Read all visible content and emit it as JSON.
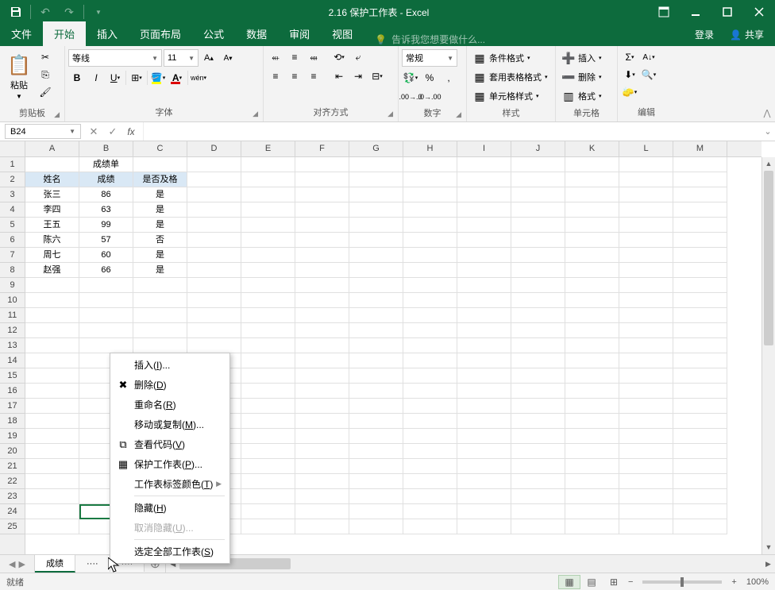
{
  "title": "2.16 保护工作表 - Excel",
  "qat": {
    "save": "💾"
  },
  "menubar_right": {
    "login": "登录",
    "share": "共享"
  },
  "tell_me": "告诉我您想要做什么...",
  "tabs": {
    "file": "文件",
    "home": "开始",
    "insert": "插入",
    "layout": "页面布局",
    "formulas": "公式",
    "data": "数据",
    "review": "审阅",
    "view": "视图"
  },
  "ribbon": {
    "clipboard": {
      "paste": "粘贴",
      "label": "剪贴板"
    },
    "font": {
      "name": "等线",
      "size": "11",
      "label": "字体"
    },
    "align": {
      "label": "对齐方式"
    },
    "number": {
      "format": "常规",
      "label": "数字"
    },
    "styles": {
      "cond": "条件格式",
      "table": "套用表格格式",
      "cell": "单元格样式",
      "label": "样式"
    },
    "cells": {
      "insert": "插入",
      "delete": "删除",
      "format": "格式",
      "label": "单元格"
    },
    "editing": {
      "label": "编辑"
    }
  },
  "namebox": "B24",
  "columns": [
    "A",
    "B",
    "C",
    "D",
    "E",
    "F",
    "G",
    "H",
    "I",
    "J",
    "K",
    "L",
    "M"
  ],
  "rows_count": 25,
  "sheet": {
    "title_cell": "成绩单",
    "headers": [
      "姓名",
      "成绩",
      "是否及格"
    ],
    "data": [
      [
        "张三",
        "86",
        "是"
      ],
      [
        "李四",
        "63",
        "是"
      ],
      [
        "王五",
        "99",
        "是"
      ],
      [
        "陈六",
        "57",
        "否"
      ],
      [
        "周七",
        "60",
        "是"
      ],
      [
        "赵强",
        "66",
        "是"
      ]
    ]
  },
  "sheet_tabs": {
    "active": "成绩",
    "hidden1": "····",
    "hidden2": "····"
  },
  "context_menu": [
    {
      "label": "插入(I)...",
      "icon": "",
      "enabled": true,
      "sub": false
    },
    {
      "label": "删除(D)",
      "icon": "✖",
      "enabled": true,
      "sub": false
    },
    {
      "label": "重命名(R)",
      "icon": "",
      "enabled": true,
      "sub": false
    },
    {
      "label": "移动或复制(M)...",
      "icon": "",
      "enabled": true,
      "sub": false
    },
    {
      "label": "查看代码(V)",
      "icon": "⧉",
      "enabled": true,
      "sub": false
    },
    {
      "label": "保护工作表(P)...",
      "icon": "▦",
      "enabled": true,
      "sub": false
    },
    {
      "label": "工作表标签颜色(T)",
      "icon": "",
      "enabled": true,
      "sub": true
    },
    {
      "label": "隐藏(H)",
      "icon": "",
      "enabled": true,
      "sub": false
    },
    {
      "label": "取消隐藏(U)...",
      "icon": "",
      "enabled": false,
      "sub": false
    },
    {
      "label": "选定全部工作表(S)",
      "icon": "",
      "enabled": true,
      "sub": false
    }
  ],
  "status": {
    "ready": "就绪",
    "zoom": "100%"
  }
}
